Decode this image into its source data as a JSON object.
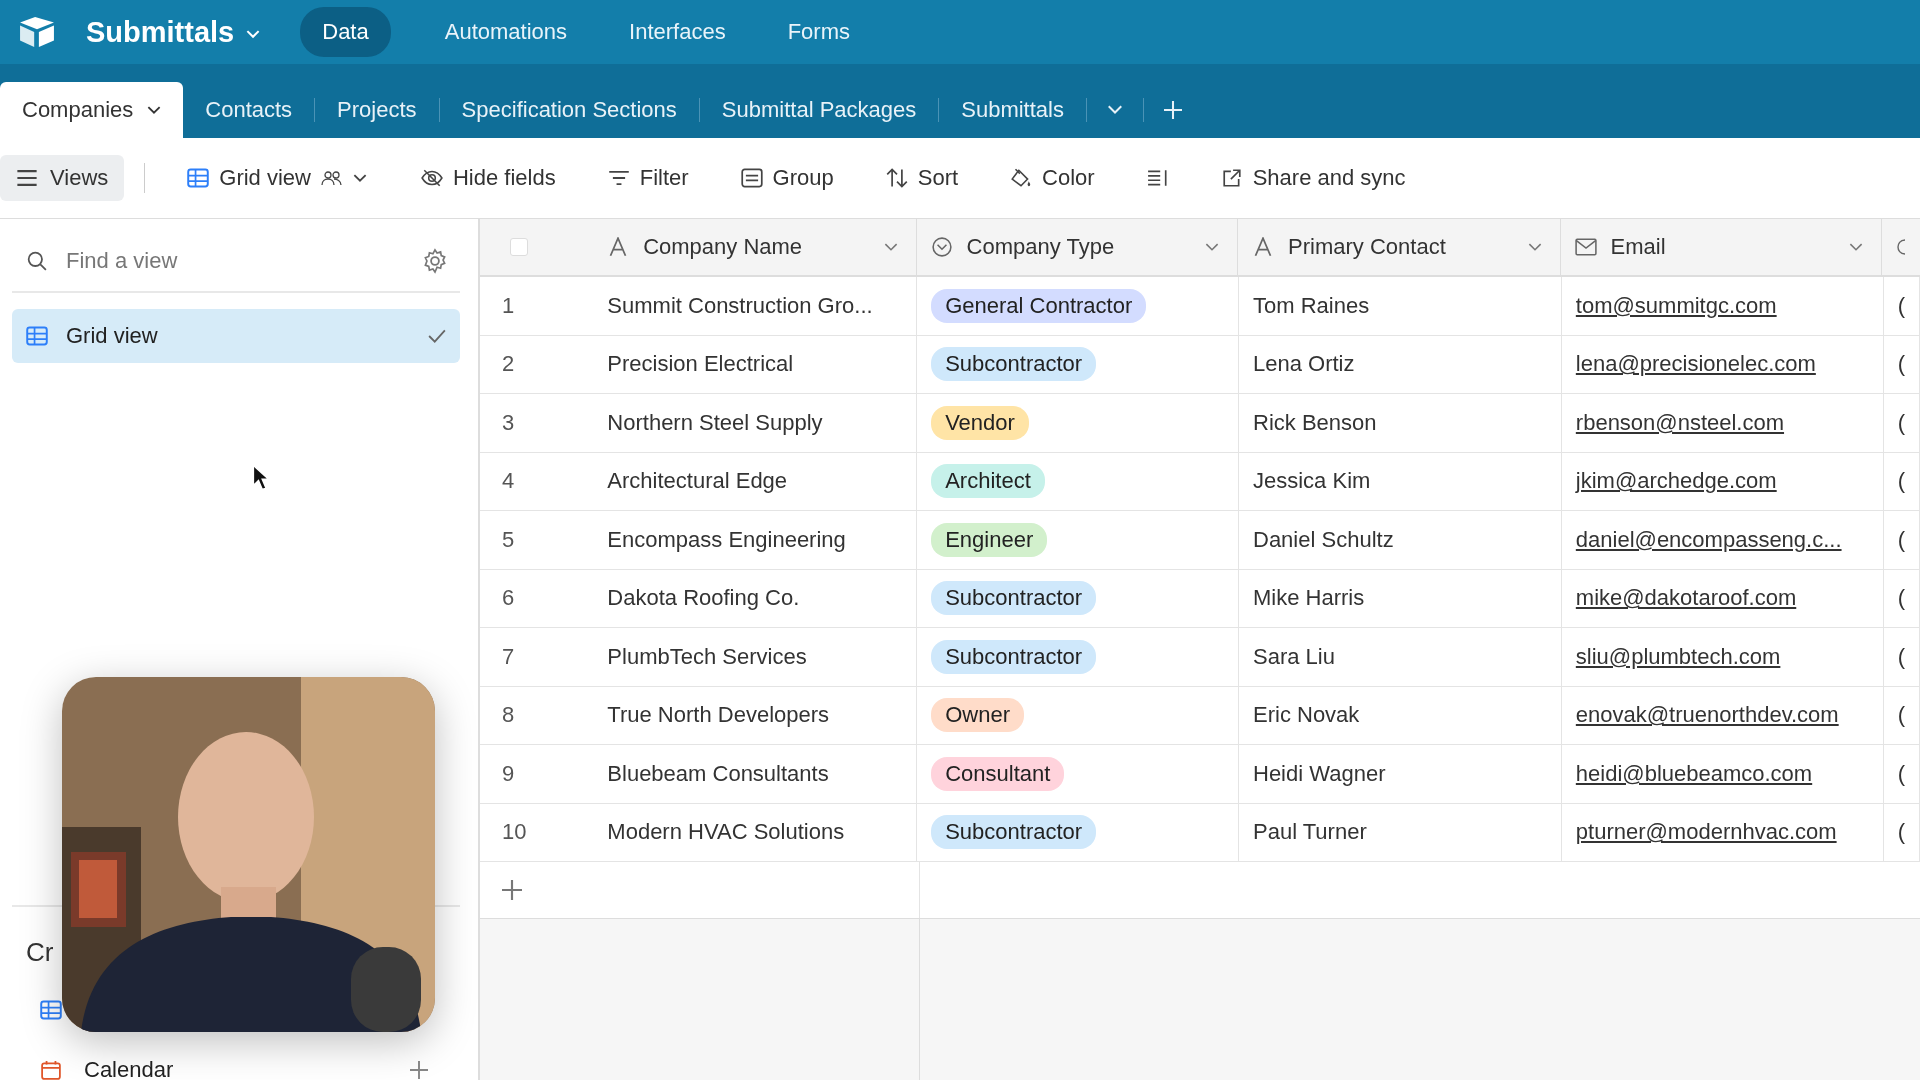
{
  "app": {
    "base_name": "Submittals",
    "nav": [
      {
        "label": "Data",
        "selected": true
      },
      {
        "label": "Automations",
        "selected": false
      },
      {
        "label": "Interfaces",
        "selected": false
      },
      {
        "label": "Forms",
        "selected": false
      }
    ]
  },
  "tables": [
    {
      "label": "Companies",
      "selected": true
    },
    {
      "label": "Contacts",
      "selected": false
    },
    {
      "label": "Projects",
      "selected": false
    },
    {
      "label": "Specification Sections",
      "selected": false
    },
    {
      "label": "Submittal Packages",
      "selected": false
    },
    {
      "label": "Submittals",
      "selected": false
    }
  ],
  "toolbar": {
    "views_label": "Views",
    "view_name": "Grid view",
    "tools": [
      {
        "kind": "hide",
        "label": "Hide fields"
      },
      {
        "kind": "filter",
        "label": "Filter"
      },
      {
        "kind": "group",
        "label": "Group"
      },
      {
        "kind": "sort",
        "label": "Sort"
      },
      {
        "kind": "color",
        "label": "Color"
      },
      {
        "kind": "row-height"
      },
      {
        "kind": "share",
        "label": "Share and sync"
      }
    ]
  },
  "sidebar": {
    "search": {
      "placeholder": "Find a view"
    },
    "views": [
      {
        "label": "Grid view",
        "selected": true
      }
    ],
    "create_heading": "Cr",
    "create_items": [
      {
        "kind": "grid"
      },
      {
        "kind": "calendar",
        "label": "Calendar"
      }
    ]
  },
  "grid": {
    "select_all": {
      "checked": false
    },
    "columns": [
      {
        "kind": "text",
        "label": "Company Name"
      },
      {
        "kind": "select",
        "label": "Company Type"
      },
      {
        "kind": "text",
        "label": "Primary Contact"
      },
      {
        "kind": "email",
        "label": "Email"
      },
      {
        "kind": "phone"
      }
    ],
    "rows": [
      {
        "number": "1",
        "name": "Summit Construction Gro...",
        "type": {
          "label": "General Contractor",
          "color": "#d3dcff"
        },
        "contact": "Tom Raines",
        "email": "tom@summitgc.com",
        "phone": "("
      },
      {
        "number": "2",
        "name": "Precision Electrical",
        "type": {
          "label": "Subcontractor",
          "color": "#cfe8fb"
        },
        "contact": "Lena Ortiz",
        "email": "lena@precisionelec.com",
        "phone": "("
      },
      {
        "number": "3",
        "name": "Northern Steel Supply",
        "type": {
          "label": "Vendor",
          "color": "#ffe4a6"
        },
        "contact": "Rick Benson",
        "email": "rbenson@nsteel.com",
        "phone": "("
      },
      {
        "number": "4",
        "name": "Architectural Edge",
        "type": {
          "label": "Architect",
          "color": "#c6f1ea"
        },
        "contact": "Jessica Kim",
        "email": "jkim@archedge.com",
        "phone": "("
      },
      {
        "number": "5",
        "name": "Encompass Engineering",
        "type": {
          "label": "Engineer",
          "color": "#d2f0cc"
        },
        "contact": "Daniel Schultz",
        "email": "daniel@encompasseng.c...",
        "phone": "("
      },
      {
        "number": "6",
        "name": "Dakota Roofing Co.",
        "type": {
          "label": "Subcontractor",
          "color": "#cfe8fb"
        },
        "contact": "Mike Harris",
        "email": "mike@dakotaroof.com",
        "phone": "("
      },
      {
        "number": "7",
        "name": "PlumbTech Services",
        "type": {
          "label": "Subcontractor",
          "color": "#cfe8fb"
        },
        "contact": "Sara Liu",
        "email": "sliu@plumbtech.com",
        "phone": "("
      },
      {
        "number": "8",
        "name": "True North Developers",
        "type": {
          "label": "Owner",
          "color": "#ffdcc9"
        },
        "contact": "Eric Novak",
        "email": "enovak@truenorthdev.com",
        "phone": "("
      },
      {
        "number": "9",
        "name": "Bluebeam Consultants",
        "type": {
          "label": "Consultant",
          "color": "#ffd3dc"
        },
        "contact": "Heidi Wagner",
        "email": "heidi@bluebeamco.com",
        "phone": "("
      },
      {
        "number": "10",
        "name": "Modern HVAC Solutions",
        "type": {
          "label": "Subcontractor",
          "color": "#cfe8fb"
        },
        "contact": "Paul Turner",
        "email": "pturner@modernhvac.com",
        "phone": "("
      }
    ]
  }
}
